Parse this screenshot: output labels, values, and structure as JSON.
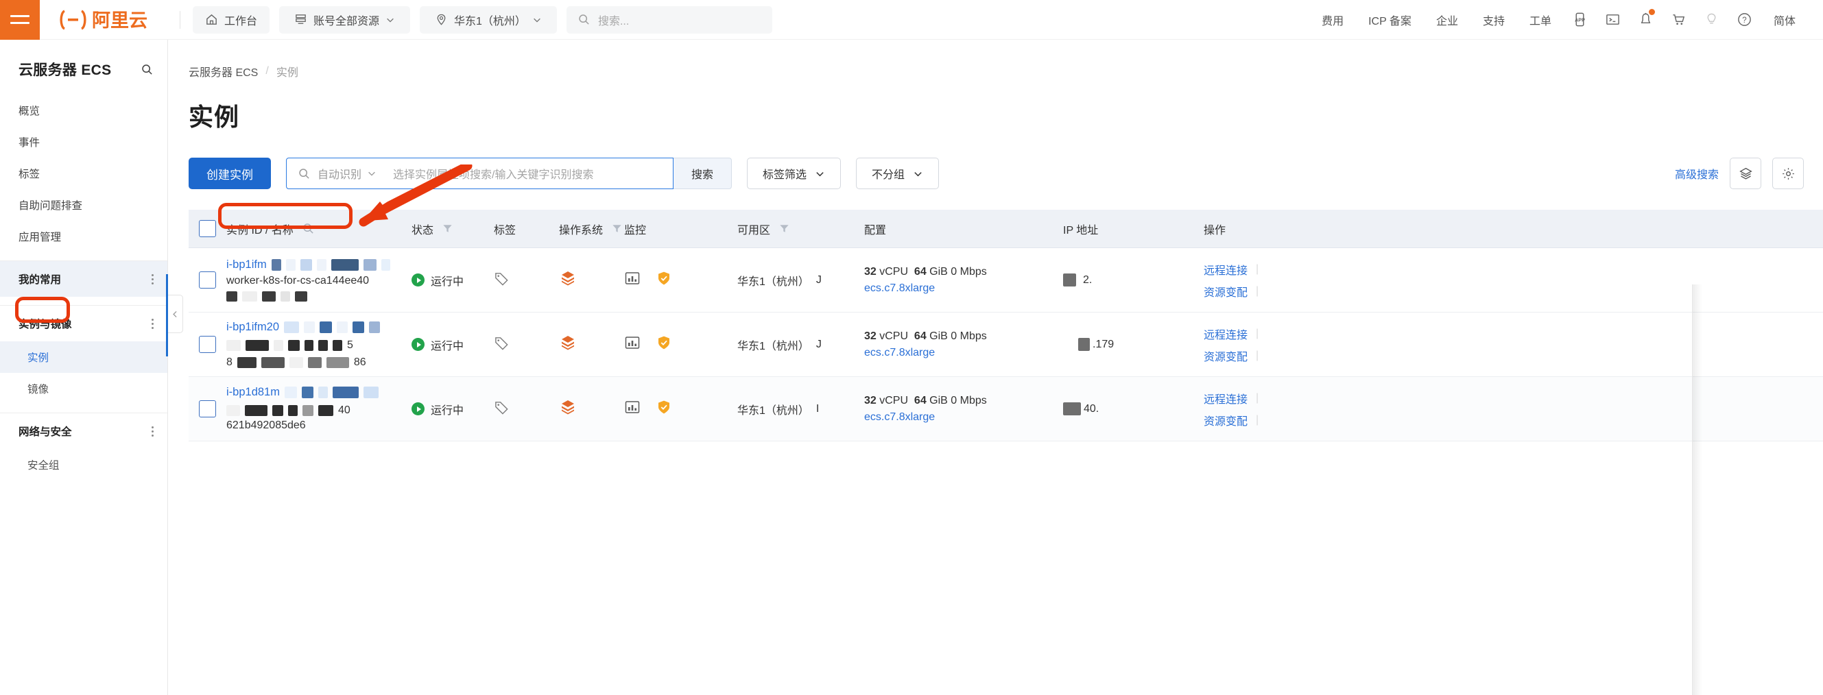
{
  "header": {
    "logo_text": "阿里云",
    "menu_icon": "hamburger-icon",
    "workbench": "工作台",
    "resources": "账号全部资源",
    "region": "华东1（杭州）",
    "search_placeholder": "搜索...",
    "links": [
      "费用",
      "ICP 备案",
      "企业",
      "支持",
      "工单"
    ],
    "icons": [
      "app-icon",
      "cloudshell-icon",
      "bell-icon",
      "cart-icon",
      "bulb-icon",
      "help-icon"
    ],
    "language": "简体",
    "accent_orange": "#ED6C1F"
  },
  "sidebar": {
    "title": "云服务器 ECS",
    "search_icon": "search-icon",
    "items": [
      {
        "label": "概览"
      },
      {
        "label": "事件"
      },
      {
        "label": "标签"
      },
      {
        "label": "自助问题排查"
      },
      {
        "label": "应用管理"
      }
    ],
    "groups": [
      {
        "label": "我的常用",
        "active": true,
        "children": []
      },
      {
        "label": "实例与镜像",
        "active": false,
        "children": [
          {
            "label": "实例",
            "selected": true
          },
          {
            "label": "镜像",
            "selected": false
          }
        ]
      },
      {
        "label": "网络与安全",
        "active": false,
        "children": [
          {
            "label": "安全组",
            "selected": false
          }
        ]
      }
    ]
  },
  "breadcrumb": {
    "root": "云服务器 ECS",
    "separator": "/",
    "current": "实例"
  },
  "page": {
    "title": "实例"
  },
  "toolbar": {
    "create_label": "创建实例",
    "search_select": "自动识别",
    "search_placeholder": "选择实例属性项搜索/输入关键字识别搜索",
    "search_button": "搜索",
    "tag_filter": "标签筛选",
    "group_filter": "不分组",
    "advanced_search": "高级搜索",
    "icons": [
      "layers-icon",
      "gear-icon"
    ]
  },
  "table": {
    "columns": [
      {
        "key": "check",
        "label": ""
      },
      {
        "key": "id",
        "label": "实例 ID / 名称",
        "icon": "search-icon"
      },
      {
        "key": "state",
        "label": "状态",
        "icon": "filter-icon"
      },
      {
        "key": "tag",
        "label": "标签"
      },
      {
        "key": "os",
        "label": "操作系统",
        "icon": "filter-icon"
      },
      {
        "key": "mon",
        "label": "监控"
      },
      {
        "key": "zone",
        "label": "可用区",
        "icon": "filter-icon"
      },
      {
        "key": "cfg",
        "label": "配置"
      },
      {
        "key": "ip",
        "label": "IP 地址"
      },
      {
        "key": "act",
        "label": "操作"
      }
    ],
    "rows": [
      {
        "instance_id": "i-bp1ifm",
        "instance_id_redacted": true,
        "instance_name": "worker-k8s-for-cs-ca144ee40",
        "name_redacted": true,
        "state": "运行中",
        "os_icon": "linux-icon",
        "monitor_icons": [
          "chart-icon",
          "shield-icon"
        ],
        "zone": "华东1（杭州）",
        "zone_suffix": "J",
        "cfg_cpu": "32",
        "cfg_cpu_unit": "vCPU",
        "cfg_mem": "64",
        "cfg_mem_unit": "GiB",
        "cfg_bandwidth": "0 Mbps",
        "cfg_type": "ecs.c7.8xlarge",
        "ip_text": "2.",
        "actions": [
          "远程连接",
          "资源变配"
        ]
      },
      {
        "instance_id": "i-bp1ifm20",
        "instance_id_redacted": true,
        "instance_name": "",
        "name_redacted": true,
        "state": "运行中",
        "os_icon": "linux-icon",
        "monitor_icons": [
          "chart-icon",
          "shield-icon"
        ],
        "zone": "华东1（杭州）",
        "zone_suffix": "J",
        "cfg_cpu": "32",
        "cfg_cpu_unit": "vCPU",
        "cfg_mem": "64",
        "cfg_mem_unit": "GiB",
        "cfg_bandwidth": "0 Mbps",
        "cfg_type": "ecs.c7.8xlarge",
        "ip_text": ".179",
        "actions": [
          "远程连接",
          "资源变配"
        ]
      },
      {
        "instance_id": "i-bp1d81m",
        "instance_id_redacted": true,
        "instance_name": "621b492085de6",
        "name_redacted": true,
        "state": "运行中",
        "os_icon": "linux-icon",
        "monitor_icons": [
          "chart-icon",
          "shield-icon"
        ],
        "zone": "华东1（杭州）",
        "zone_suffix": "I",
        "cfg_cpu": "32",
        "cfg_cpu_unit": "vCPU",
        "cfg_mem": "64",
        "cfg_mem_unit": "GiB",
        "cfg_bandwidth": "0 Mbps",
        "cfg_type": "ecs.c7.8xlarge",
        "ip_text": "40.",
        "actions": [
          "远程连接",
          "资源变配"
        ]
      }
    ]
  },
  "annotations": {
    "highlight_color": "#E8380D",
    "boxes": [
      "instance-id-highlight",
      "sidebar-instance-highlight"
    ],
    "arrow": "pointer-arrow"
  }
}
